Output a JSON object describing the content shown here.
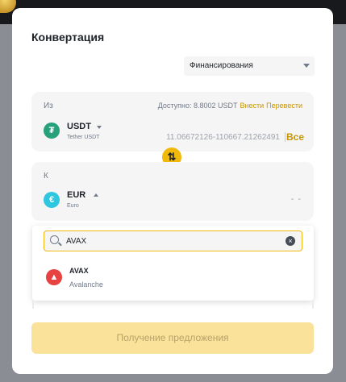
{
  "title": "Конвертация",
  "wallet_select": {
    "value": "Финансирования"
  },
  "from": {
    "label": "Из",
    "available": "Доступно: 8.8002 USDT",
    "deposit_link": "Внести",
    "transfer_link": "Перевести",
    "ticker": "USDT",
    "name": "Tether USDT",
    "range": "11.06672126-110667.21262491",
    "max_label": "Все",
    "icon": "tether-icon",
    "icon_glyph": "₮"
  },
  "swap_icon": "swap-icon",
  "to": {
    "label": "К",
    "ticker": "EUR",
    "name": "Euro",
    "amount": "- -",
    "icon": "euro-icon",
    "icon_glyph": "€"
  },
  "search": {
    "value": "AVAX",
    "clear_glyph": "×"
  },
  "options": [
    {
      "ticker": "AVAX",
      "name": "Avalanche",
      "icon": "avalanche-icon",
      "icon_glyph": "▲"
    }
  ],
  "submit_button": "Получение предложения",
  "colors": {
    "accent": "#f0b90b",
    "link": "#c99400",
    "tether": "#26a17b",
    "euro": "#2fc6e0",
    "avalanche": "#e84142"
  }
}
